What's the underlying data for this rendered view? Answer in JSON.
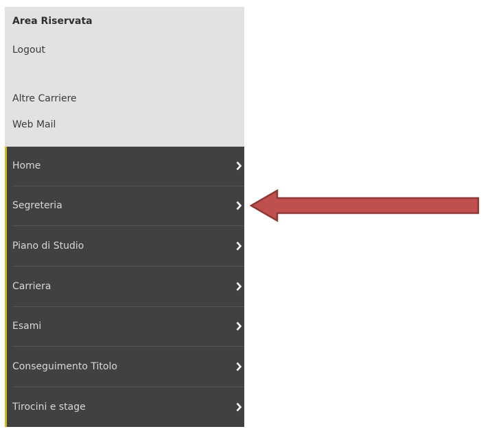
{
  "top_panel": {
    "title": "Area Riservata",
    "links": [
      "Logout",
      "Altre Carriere",
      "Web Mail"
    ]
  },
  "menu": {
    "items": [
      "Home",
      "Segreteria",
      "Piano di Studio",
      "Carriera",
      "Esami",
      "Conseguimento Titolo",
      "Tirocini e stage"
    ]
  },
  "colors": {
    "top_panel_bg": "#e2e2e2",
    "menu_bg": "#414141",
    "accent": "#d5b81c",
    "arrow_fill": "#c0504d",
    "arrow_stroke": "#8c3836"
  },
  "annotation": {
    "icon": "left-pointing-arrow",
    "points_to_item": "Segreteria"
  }
}
